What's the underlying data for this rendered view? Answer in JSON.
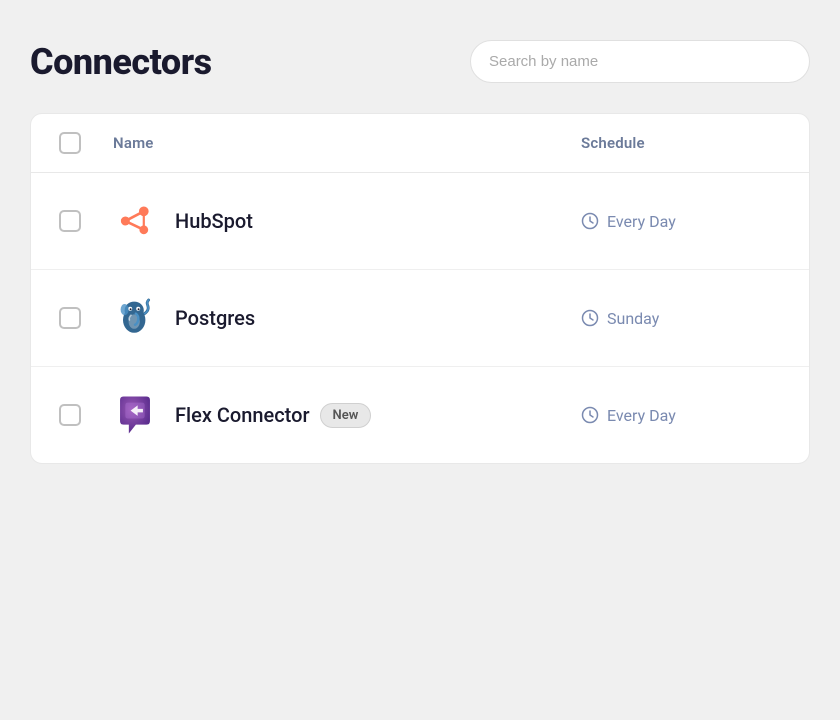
{
  "page": {
    "title": "Connectors",
    "search_placeholder": "Search by name"
  },
  "table": {
    "columns": {
      "name": "Name",
      "schedule": "Schedule"
    },
    "rows": [
      {
        "id": "hubspot",
        "name": "HubSpot",
        "schedule": "Every Day",
        "is_new": false,
        "icon_type": "hubspot"
      },
      {
        "id": "postgres",
        "name": "Postgres",
        "schedule": "Sunday",
        "is_new": false,
        "icon_type": "postgres"
      },
      {
        "id": "flex-connector",
        "name": "Flex Connector",
        "schedule": "Every Day",
        "is_new": true,
        "new_badge_label": "New",
        "icon_type": "flex"
      }
    ]
  }
}
